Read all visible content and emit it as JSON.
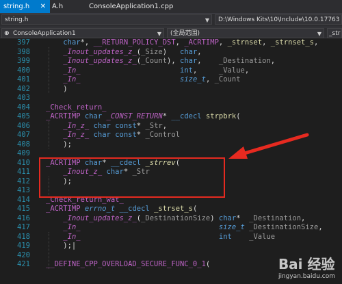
{
  "tabs": [
    {
      "label": "string.h",
      "active": true,
      "close": "✕"
    },
    {
      "label": "A.h",
      "active": false
    },
    {
      "label": "ConsoleApplication1.cpp",
      "active": false
    }
  ],
  "file_bar": {
    "file": "string.h",
    "path": "D:\\Windows Kits\\10\\Include\\10.0.17763"
  },
  "nav_bar": {
    "project": "ConsoleApplication1",
    "scope": "(全局范围)",
    "member": "_str"
  },
  "code_lines": [
    {
      "num": "397",
      "text": "    char*, __RETURN_POLICY_DST, _ACRTIMP, _strnset, _strnset_s,"
    },
    {
      "num": "398",
      "text": "    _Inout_updates_z_(_Size)   char,"
    },
    {
      "num": "399",
      "text": "    _Inout_updates_z_(_Count), char,    _Destination,"
    },
    {
      "num": "400",
      "text": "    _In_                       int,     _Value,"
    },
    {
      "num": "401",
      "text": "    _In_                       size_t, _Count"
    },
    {
      "num": "402",
      "text": "    )"
    },
    {
      "num": "403",
      "text": ""
    },
    {
      "num": "404",
      "text": "_Check_return_"
    },
    {
      "num": "405",
      "text": "_ACRTIMP char _CONST_RETURN* __cdecl strpbrk("
    },
    {
      "num": "406",
      "text": "    _In_z_ char const* _Str,"
    },
    {
      "num": "407",
      "text": "    _In_z_ char const* _Control"
    },
    {
      "num": "408",
      "text": "    );"
    },
    {
      "num": "409",
      "text": ""
    },
    {
      "num": "410",
      "text": "_ACRTIMP char* __cdecl _strrev("
    },
    {
      "num": "411",
      "text": "    _Inout_z_ char* _Str"
    },
    {
      "num": "412",
      "text": "    );"
    },
    {
      "num": "413",
      "text": ""
    },
    {
      "num": "414",
      "text": "_Check_return_wat_"
    },
    {
      "num": "415",
      "text": "_ACRTIMP errno_t __cdecl _strset_s("
    },
    {
      "num": "416",
      "text": "    _Inout_updates_z_(_DestinationSize) char*  _Destination,"
    },
    {
      "num": "417",
      "text": "    _In_                                size_t _DestinationSize,"
    },
    {
      "num": "418",
      "text": "    _In_                                int    _Value"
    },
    {
      "num": "419",
      "text": "    );|"
    },
    {
      "num": "420",
      "text": ""
    },
    {
      "num": "421",
      "text": "__DEFINE_CPP_OVERLOAD_SECURE_FUNC_0_1("
    }
  ],
  "watermark": {
    "brand": "Bai 经验",
    "site": "jingyan.baidu.com"
  },
  "colors": {
    "editor_bg": "#1e1e1e",
    "line_number": "#2b91af",
    "keyword": "#569cd6",
    "macro": "#bd63c5",
    "annotation": "#bd63c5",
    "function": "#dcdcaa",
    "param": "#9a9a9a",
    "highlight_box": "#e62a20"
  },
  "icons": [
    "close-icon",
    "pin-icon",
    "dropdown-icon",
    "project-icon",
    "arrow-annotation"
  ]
}
